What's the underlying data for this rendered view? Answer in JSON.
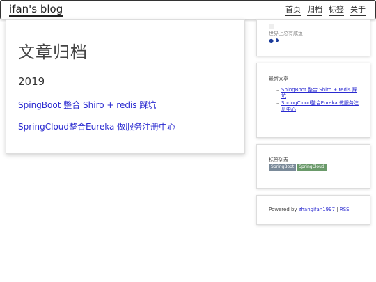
{
  "nav": {
    "brand": "ifan's blog",
    "links": [
      "首页",
      "归档",
      "标签",
      "关于"
    ]
  },
  "archive": {
    "title": "文章归档",
    "year": "2019",
    "posts": [
      "SpingBoot 整合 Shiro + redis 踩坑",
      "SpringCloud整合Eureka 做服务注册中心"
    ]
  },
  "sidebar": {
    "motto": "世界上总有咸鱼",
    "social_icons": [
      "github-icon",
      "twitter-icon"
    ],
    "recent_title": "最新文章",
    "recent_posts": [
      "SpingBoot 整合 Shiro + redis 踩坑",
      "SpringCloud整合Eureka 做服务注册中心"
    ],
    "tags_title": "标签列表",
    "tags": [
      "SpringBoot",
      "SpringCloud"
    ],
    "footer_prefix": "Powered by ",
    "footer_author": "zhangifan1997",
    "footer_sep": " | ",
    "footer_rss": "RSS"
  },
  "colors": {
    "link": "#2a2ad0",
    "tag_springboot": "#7a8a99",
    "tag_springcloud": "#6a9a6a"
  }
}
